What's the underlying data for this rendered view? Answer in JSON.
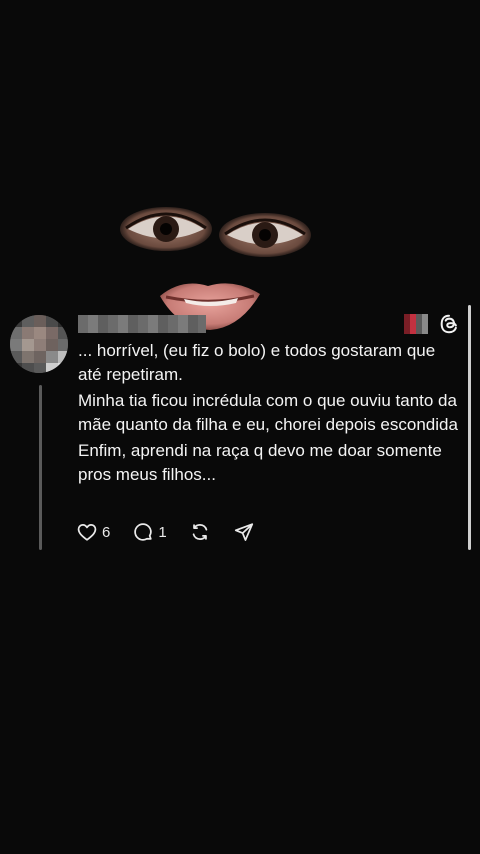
{
  "post": {
    "username": "",
    "paragraphs": [
      "... horrível, (eu fiz o bolo) e todos gostaram que até repetiram.",
      "Minha tia ficou incrédula com o que ouviu tanto da mãe quanto da filha e eu, chorei depois escondida",
      "Enfim, aprendi na raça q devo me doar somente pros meus filhos..."
    ],
    "likes": "6",
    "replies": "1",
    "icons": {
      "like": "heart-icon",
      "reply": "comment-icon",
      "repost": "repost-icon",
      "share": "send-icon",
      "app": "threads-logo-icon"
    }
  },
  "colors": {
    "background": "#090909",
    "text": "#f4f4f4",
    "thread_line": "#5a5a5a"
  }
}
